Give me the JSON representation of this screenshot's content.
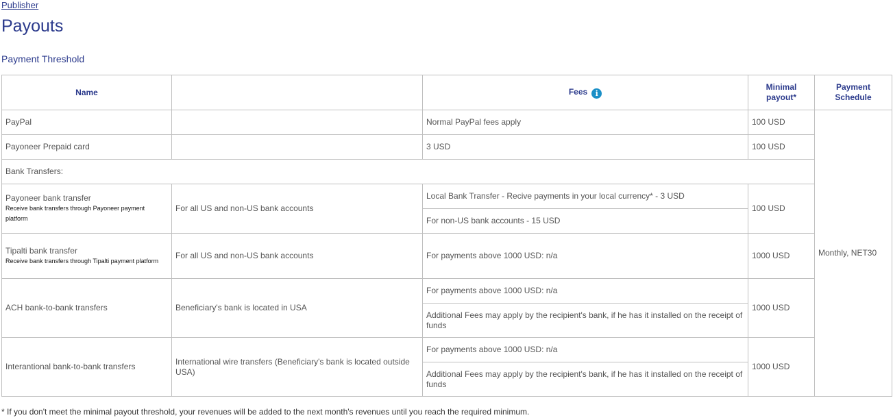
{
  "breadcrumb": "Publisher",
  "page_title": "Payouts",
  "section_title": "Payment Threshold",
  "table": {
    "headers": {
      "name": "Name",
      "description": "",
      "fees": "Fees",
      "fees_icon": "info-icon",
      "minimal_payout": "Minimal payout*",
      "payment_schedule": "Payment Schedule"
    },
    "schedule": "Monthly, NET30",
    "paypal": {
      "name": "PayPal",
      "fee": "Normal PayPal fees apply",
      "min": "100 USD"
    },
    "payoneer_card": {
      "name": "Payoneer Prepaid card",
      "fee": "3 USD",
      "min": "100 USD"
    },
    "bank_transfers_label": "Bank Transfers:",
    "payoneer_bank": {
      "name": "Payoneer bank transfer",
      "sub": "Receive bank transfers through Payoneer payment platform",
      "desc": "For all US and non-US bank accounts",
      "fee1": "Local Bank Transfer - Recive payments in your local currency* - 3 USD",
      "fee2": "For non-US bank accounts - 15 USD",
      "min": "100 USD"
    },
    "tipalti": {
      "name": "Tipalti bank transfer",
      "sub": "Receive bank transfers through Tipalti payment platform",
      "desc": "For all US and non-US bank accounts",
      "fee": "For payments above 1000 USD: n/a",
      "min": "1000 USD"
    },
    "ach": {
      "name": "ACH bank-to-bank transfers",
      "desc": "Beneficiary's bank is located in USA",
      "fee1": "For payments above 1000 USD: n/a",
      "fee2": "Additional Fees may apply by the recipient's bank, if he has it installed on the receipt of funds",
      "min": "1000 USD"
    },
    "international": {
      "name": "Interantional bank-to-bank transfers",
      "desc": "International wire transfers (Beneficiary's bank is located outside USA)",
      "fee1": "For payments above 1000 USD: n/a",
      "fee2": "Additional Fees may apply by the recipient's bank, if he has it installed on the receipt of funds",
      "min": "1000 USD"
    }
  },
  "footnote": "* If you don't meet the minimal payout threshold, your revenues will be added to the next month's revenues until you reach the required minimum."
}
